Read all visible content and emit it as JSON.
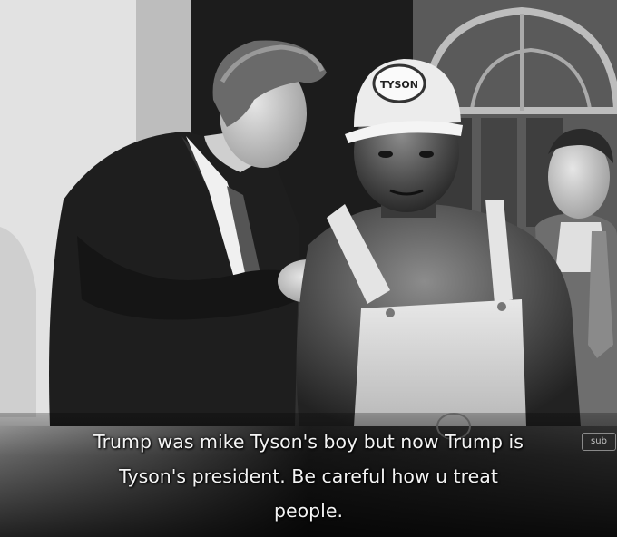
{
  "caption": {
    "line1": "Trump was mike Tyson's boy but now Trump is",
    "line2": "Tyson's president. Be careful how u treat",
    "line3": "people."
  },
  "cap_logo_text": "TYSON",
  "watermark_text": "sub",
  "colors": {
    "background": "#000000",
    "caption_text": "#f4f4f4"
  }
}
